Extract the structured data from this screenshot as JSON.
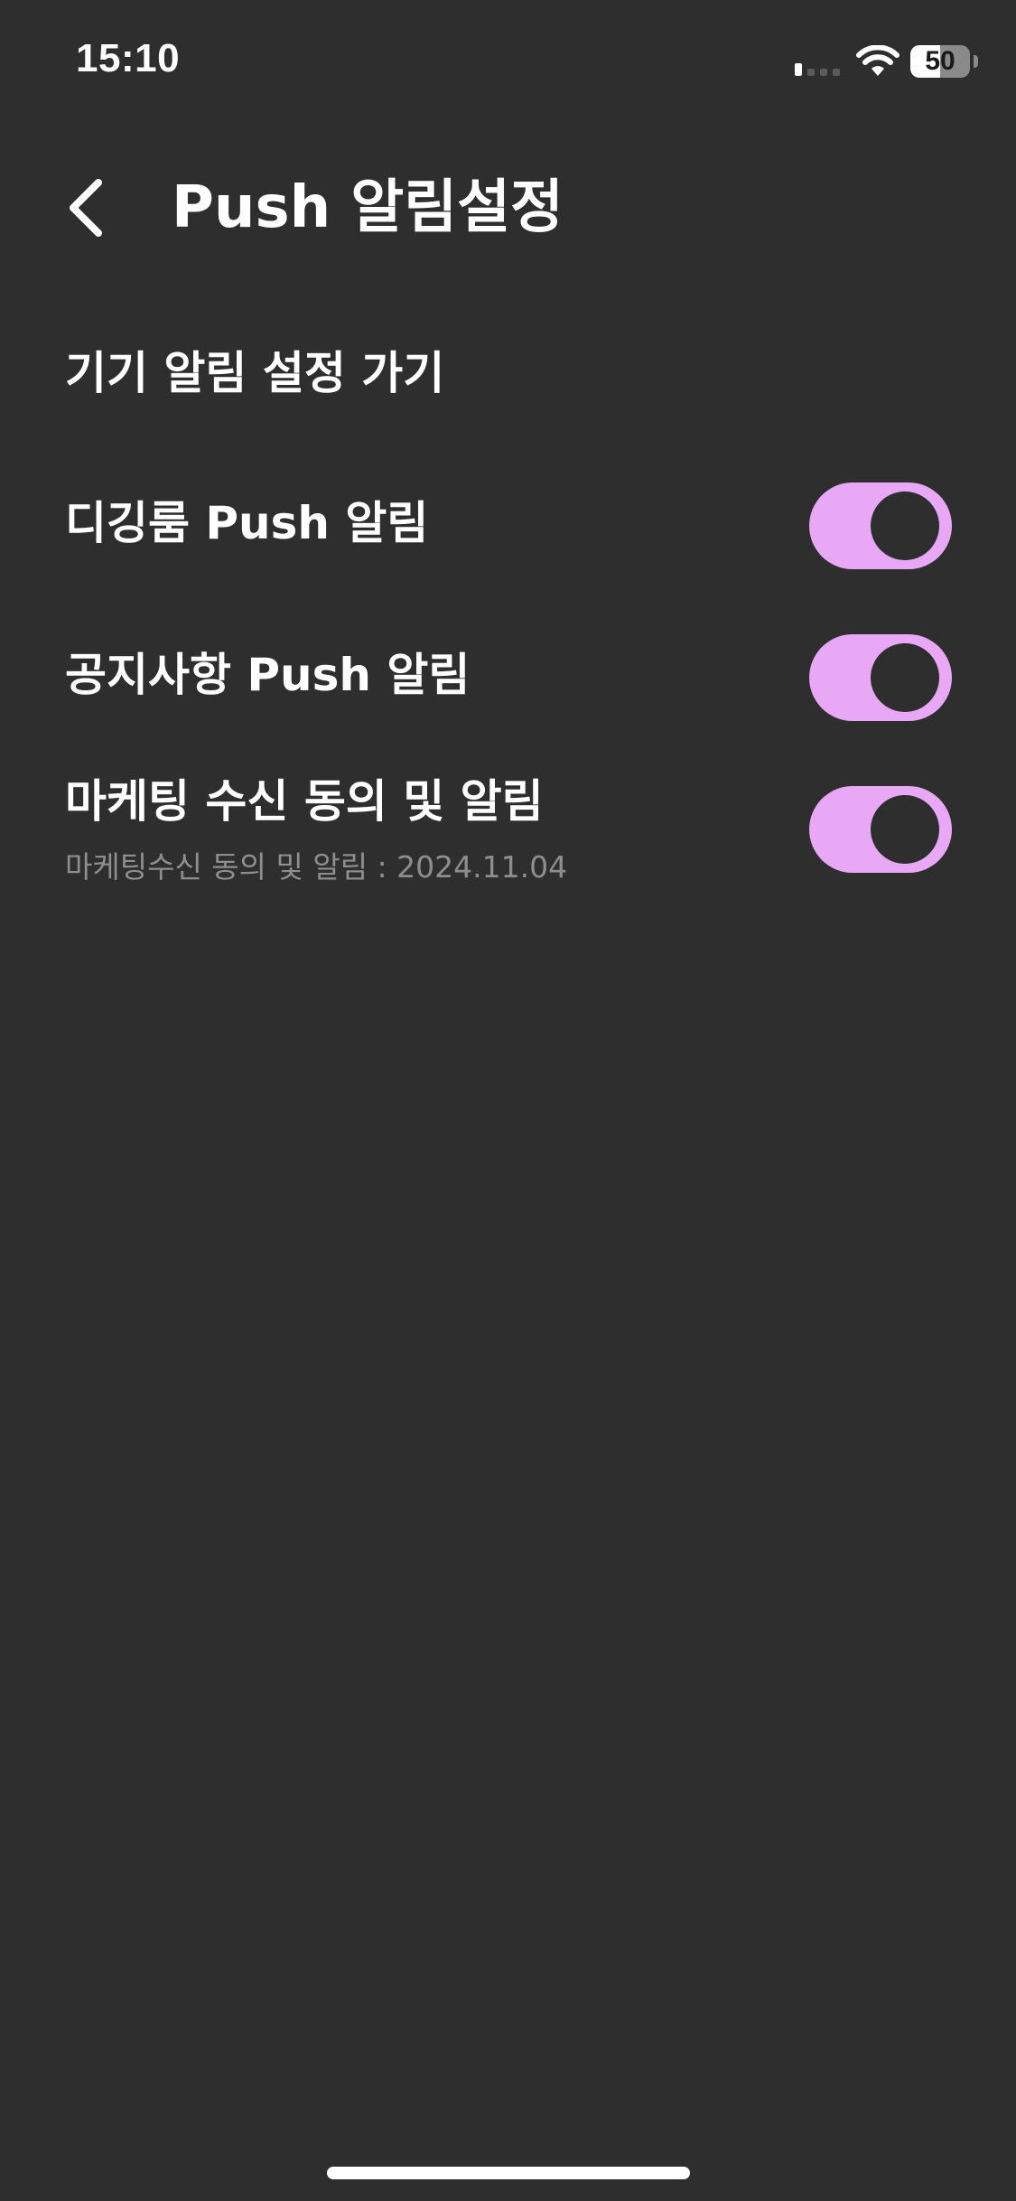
{
  "status_bar": {
    "time": "15:10",
    "battery_level": "50",
    "battery_fraction": 0.5,
    "signal_icon": "cellular-signal-icon",
    "wifi_icon": "wifi-icon"
  },
  "header": {
    "back_icon": "chevron-left-icon",
    "title": "Push 알림설정"
  },
  "settings": {
    "device_link_label": "기기 알림 설정 가기",
    "toggles": [
      {
        "label": "디깅룸 Push 알림",
        "on": true
      },
      {
        "label": "공지사항 Push 알림",
        "on": true
      },
      {
        "label": "마케팅 수신 동의 및 알림",
        "sublabel": "마케팅수신 동의 및 알림 : 2024.11.04",
        "on": true
      }
    ]
  },
  "colors": {
    "background": "#2e2e2e",
    "toggle_on": "#e8a8f6",
    "sublabel": "#8e8e8e"
  }
}
